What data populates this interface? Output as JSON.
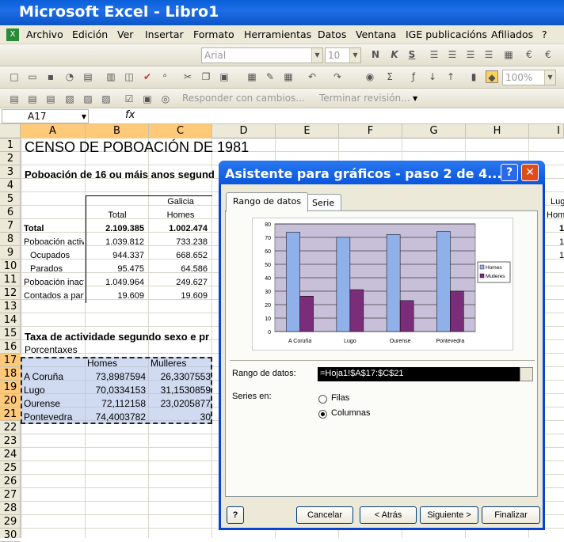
{
  "window": {
    "title": "Microsoft Excel - Libro1"
  },
  "menu": [
    "Archivo",
    "Edición",
    "Ver",
    "Insertar",
    "Formato",
    "Herramientas",
    "Datos",
    "Ventana",
    "IGE publicacións",
    "Afiliados",
    "?"
  ],
  "toolbar": {
    "font": "Arial",
    "size": "10",
    "zoom": "100%",
    "reply": "Responder con cambios...",
    "end_review": "Terminar revisión..."
  },
  "formula": {
    "namebox": "A17",
    "fx": "fx"
  },
  "columns": [
    "A",
    "B",
    "C",
    "D",
    "E",
    "F",
    "G",
    "H",
    "I"
  ],
  "rows": [
    "1",
    "2",
    "3",
    "4",
    "5",
    "6",
    "7",
    "8",
    "9",
    "10",
    "11",
    "12",
    "13",
    "14",
    "15",
    "16",
    "17",
    "18",
    "19",
    "20",
    "21",
    "22",
    "23",
    "24",
    "25",
    "26",
    "27",
    "28",
    "29",
    "30"
  ],
  "sheet": {
    "title": "CENSO DE POBOACIÓN DE 1981",
    "subtitle": "Poboación de 16 ou máis anos segund",
    "galicia": "Galicia",
    "total_h": "Total",
    "homes_h": "Homes",
    "rows": [
      {
        "label": "Total",
        "total": "2.109.385",
        "homes": "1.002.474",
        "bold": true
      },
      {
        "label": "Poboación activa",
        "total": "1.039.812",
        "homes": "733.238"
      },
      {
        "label": "Ocupados",
        "total": "944.337",
        "homes": "668.652"
      },
      {
        "label": "Parados",
        "total": "95.475",
        "homes": "64.586"
      },
      {
        "label": "Poboación inacti",
        "total": "1.049.964",
        "homes": "249.627"
      },
      {
        "label": "Contados a part",
        "total": "19.609",
        "homes": "19.609"
      }
    ],
    "taxa_title": "Taxa de actividade segundo sexo e pr",
    "porcentaxes": "Porcentaxes",
    "hdr_homes": "Homes",
    "hdr_mulleres": "Mulleres",
    "data": [
      {
        "prov": "A Coruña",
        "homes": "73,8987594",
        "mulleres": "26,3307553"
      },
      {
        "prov": "Lugo",
        "homes": "70,0334153",
        "mulleres": "31,1530859"
      },
      {
        "prov": "Ourense",
        "homes": "72,112158",
        "mulleres": "23,0205877"
      },
      {
        "prov": "Pontevedra",
        "homes": "74,4003782",
        "mulleres": "30"
      }
    ],
    "right_partial": {
      "lu": "Lug",
      "hom": "Hom",
      "v7": "1",
      "v8": "1",
      "v9": "1"
    }
  },
  "dialog": {
    "title": "Asistente para gráficos - paso 2 de 4...",
    "help": "?",
    "close": "X",
    "tabs": [
      "Rango de datos",
      "Serie"
    ],
    "range_label": "Rango de datos:",
    "range_value": "=Hoja1!$A$17:$C$21",
    "series_label": "Series en:",
    "opt_rows": "Filas",
    "opt_cols": "Columnas",
    "buttons": {
      "cancel": "Cancelar",
      "back": "< Atrás",
      "next": "Siguiente >",
      "finish": "Finalizar"
    }
  },
  "chart_data": {
    "type": "bar",
    "categories": [
      "A Coruña",
      "Lugo",
      "Ourense",
      "Pontevedra"
    ],
    "series": [
      {
        "name": "Homes",
        "values": [
          73.9,
          70.03,
          72.11,
          74.4
        ],
        "color": "#8fb0e8"
      },
      {
        "name": "Mulleres",
        "values": [
          26.33,
          31.15,
          23.02,
          30
        ],
        "color": "#7a2e7a"
      }
    ],
    "ylim": [
      0,
      80
    ],
    "yticks": [
      0,
      10,
      20,
      30,
      40,
      50,
      60,
      70,
      80
    ],
    "plot_bg": "#c8bfd8",
    "legend": "right"
  }
}
